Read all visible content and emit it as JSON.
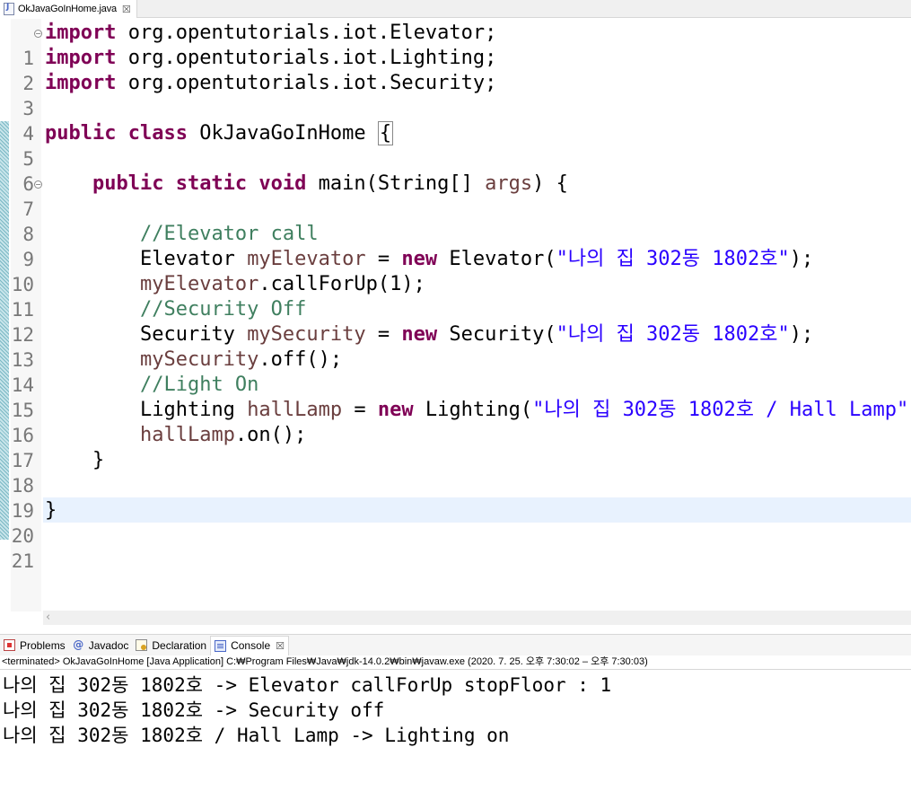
{
  "editor_tab": {
    "label": "OkJavaGoInHome.java",
    "close": "☒"
  },
  "code": {
    "l1": {
      "n": "1",
      "kw": "import",
      "rest": " org.opentutorials.iot.Elevator;"
    },
    "l2": {
      "n": "2",
      "kw": "import",
      "rest": " org.opentutorials.iot.Lighting;"
    },
    "l3": {
      "n": "3",
      "kw": "import",
      "rest": " org.opentutorials.iot.Security;"
    },
    "l4": {
      "n": "4"
    },
    "l5": {
      "n": "5",
      "kw": "public class",
      "name": " OkJavaGoInHome ",
      "brace": "{"
    },
    "l6": {
      "n": "6"
    },
    "l7": {
      "n": "7",
      "indent": "    ",
      "kw": "public static void",
      "pre": " main(String[] ",
      "var": "args",
      "post": ") {"
    },
    "l8": {
      "n": "8"
    },
    "l9": {
      "n": "9",
      "indent": "        ",
      "comment": "//Elevator call"
    },
    "l10": {
      "n": "10",
      "indent": "        ",
      "type": "Elevator ",
      "var": "myElevator",
      "eq": " = ",
      "kw": "new",
      "call": " Elevator(",
      "str": "\"나의 집 302동 1802호\"",
      "end": ");"
    },
    "l11": {
      "n": "11",
      "indent": "        ",
      "var": "myElevator",
      "rest": ".callForUp(1);"
    },
    "l12": {
      "n": "12",
      "indent": "        ",
      "comment": "//Security Off"
    },
    "l13": {
      "n": "13",
      "indent": "        ",
      "type": "Security ",
      "var": "mySecurity",
      "eq": " = ",
      "kw": "new",
      "call": " Security(",
      "str": "\"나의 집 302동 1802호\"",
      "end": ");"
    },
    "l14": {
      "n": "14",
      "indent": "        ",
      "var": "mySecurity",
      "rest": ".off();"
    },
    "l15": {
      "n": "15",
      "indent": "        ",
      "comment": "//Light On"
    },
    "l16": {
      "n": "16",
      "indent": "        ",
      "type": "Lighting ",
      "var": "hallLamp",
      "eq": " = ",
      "kw": "new",
      "call": " Lighting(",
      "str": "\"나의 집 302동 1802호 / Hall Lamp\"",
      "end": ");"
    },
    "l17": {
      "n": "17",
      "indent": "        ",
      "var": "hallLamp",
      "rest": ".on();"
    },
    "l18": {
      "n": "18",
      "text": "    }"
    },
    "l19": {
      "n": "19"
    },
    "l20": {
      "n": "20",
      "text": "}"
    },
    "l21": {
      "n": "21"
    }
  },
  "panel_tabs": {
    "problems": "Problems",
    "javadoc": "Javadoc",
    "javadoc_symbol": "@",
    "declaration": "Declaration",
    "console": "Console",
    "console_close": "☒"
  },
  "console": {
    "status": "<terminated> OkJavaGoInHome [Java Application] C:₩Program Files₩Java₩jdk-14.0.2₩bin₩javaw.exe  (2020. 7. 25. 오후 7:30:02 – 오후 7:30:03)",
    "output": [
      "나의 집 302동 1802호 -> Elevator callForUp stopFloor : 1",
      "나의 집 302동 1802호 -> Security off",
      "나의 집 302동 1802호 / Hall Lamp -> Lighting on"
    ]
  },
  "colors": {
    "keyword": "#7f0055",
    "comment": "#3f7f5f",
    "string": "#2a00ff",
    "local_variable": "#6a3e3e",
    "current_line": "#e8f2fe"
  }
}
